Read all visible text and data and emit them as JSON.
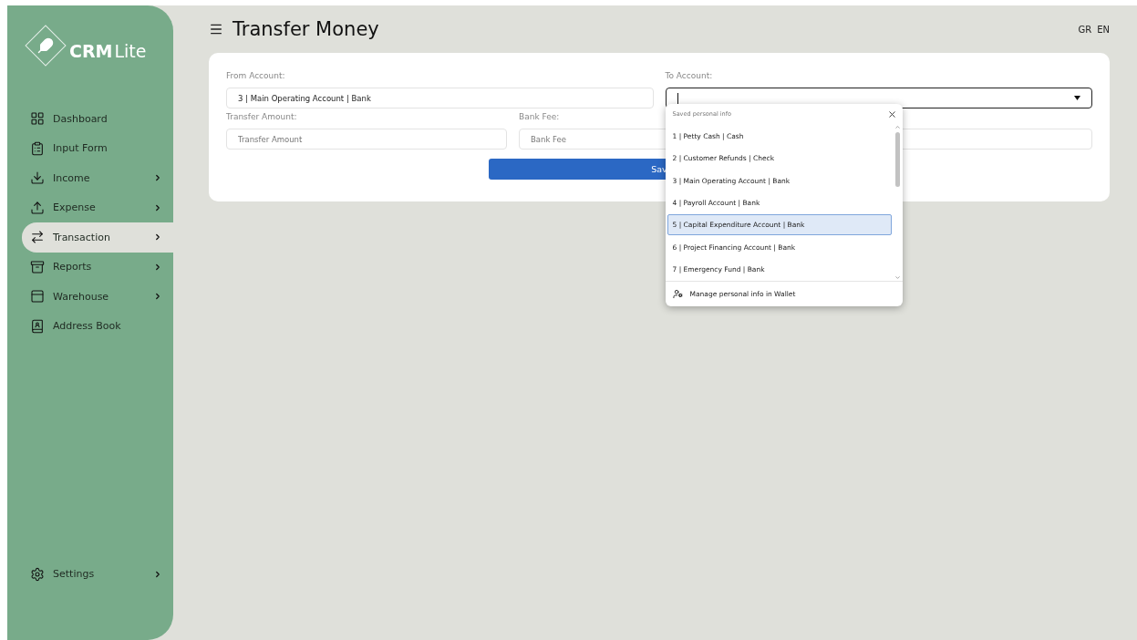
{
  "sidebar": {
    "logo": {
      "brand": "CRM",
      "suffix": "Lite"
    },
    "items": [
      {
        "label": "Dashboard",
        "has_submenu": false,
        "selected": false
      },
      {
        "label": "Input Form",
        "has_submenu": false,
        "selected": false
      },
      {
        "label": "Income",
        "has_submenu": true,
        "selected": false
      },
      {
        "label": "Expense",
        "has_submenu": true,
        "selected": false
      },
      {
        "label": "Transaction",
        "has_submenu": true,
        "selected": true
      },
      {
        "label": "Reports",
        "has_submenu": true,
        "selected": false
      },
      {
        "label": "Warehouse",
        "has_submenu": true,
        "selected": false
      },
      {
        "label": "Address Book",
        "has_submenu": false,
        "selected": false
      }
    ],
    "footer_items": [
      {
        "label": "Settings",
        "has_submenu": true,
        "selected": false
      }
    ]
  },
  "header": {
    "title": "Transfer Money",
    "languages": [
      "GR",
      "EN"
    ]
  },
  "form": {
    "from_account": {
      "label": "From Account:",
      "value": "3 | Main Operating Account | Bank"
    },
    "to_account": {
      "label": "To Account:"
    },
    "transfer_amount": {
      "label": "Transfer Amount:",
      "placeholder": "Transfer Amount"
    },
    "bank_fee": {
      "label": "Bank Fee:",
      "placeholder": "Bank Fee"
    },
    "save_button": "Sav"
  },
  "autofill_popup": {
    "title": "Saved personal info",
    "items": [
      {
        "label": "1 | Petty Cash | Cash",
        "selected": false
      },
      {
        "label": "2 | Customer Refunds | Check",
        "selected": false
      },
      {
        "label": "3 | Main Operating Account | Bank",
        "selected": false
      },
      {
        "label": "4 | Payroll Account | Bank",
        "selected": false
      },
      {
        "label": "5 | Capital Expenditure Account | Bank",
        "selected": true
      },
      {
        "label": "6 | Project Financing Account | Bank",
        "selected": false
      },
      {
        "label": "7 | Emergency Fund | Bank",
        "selected": false
      }
    ],
    "footer": "Manage personal info in Wallet"
  }
}
